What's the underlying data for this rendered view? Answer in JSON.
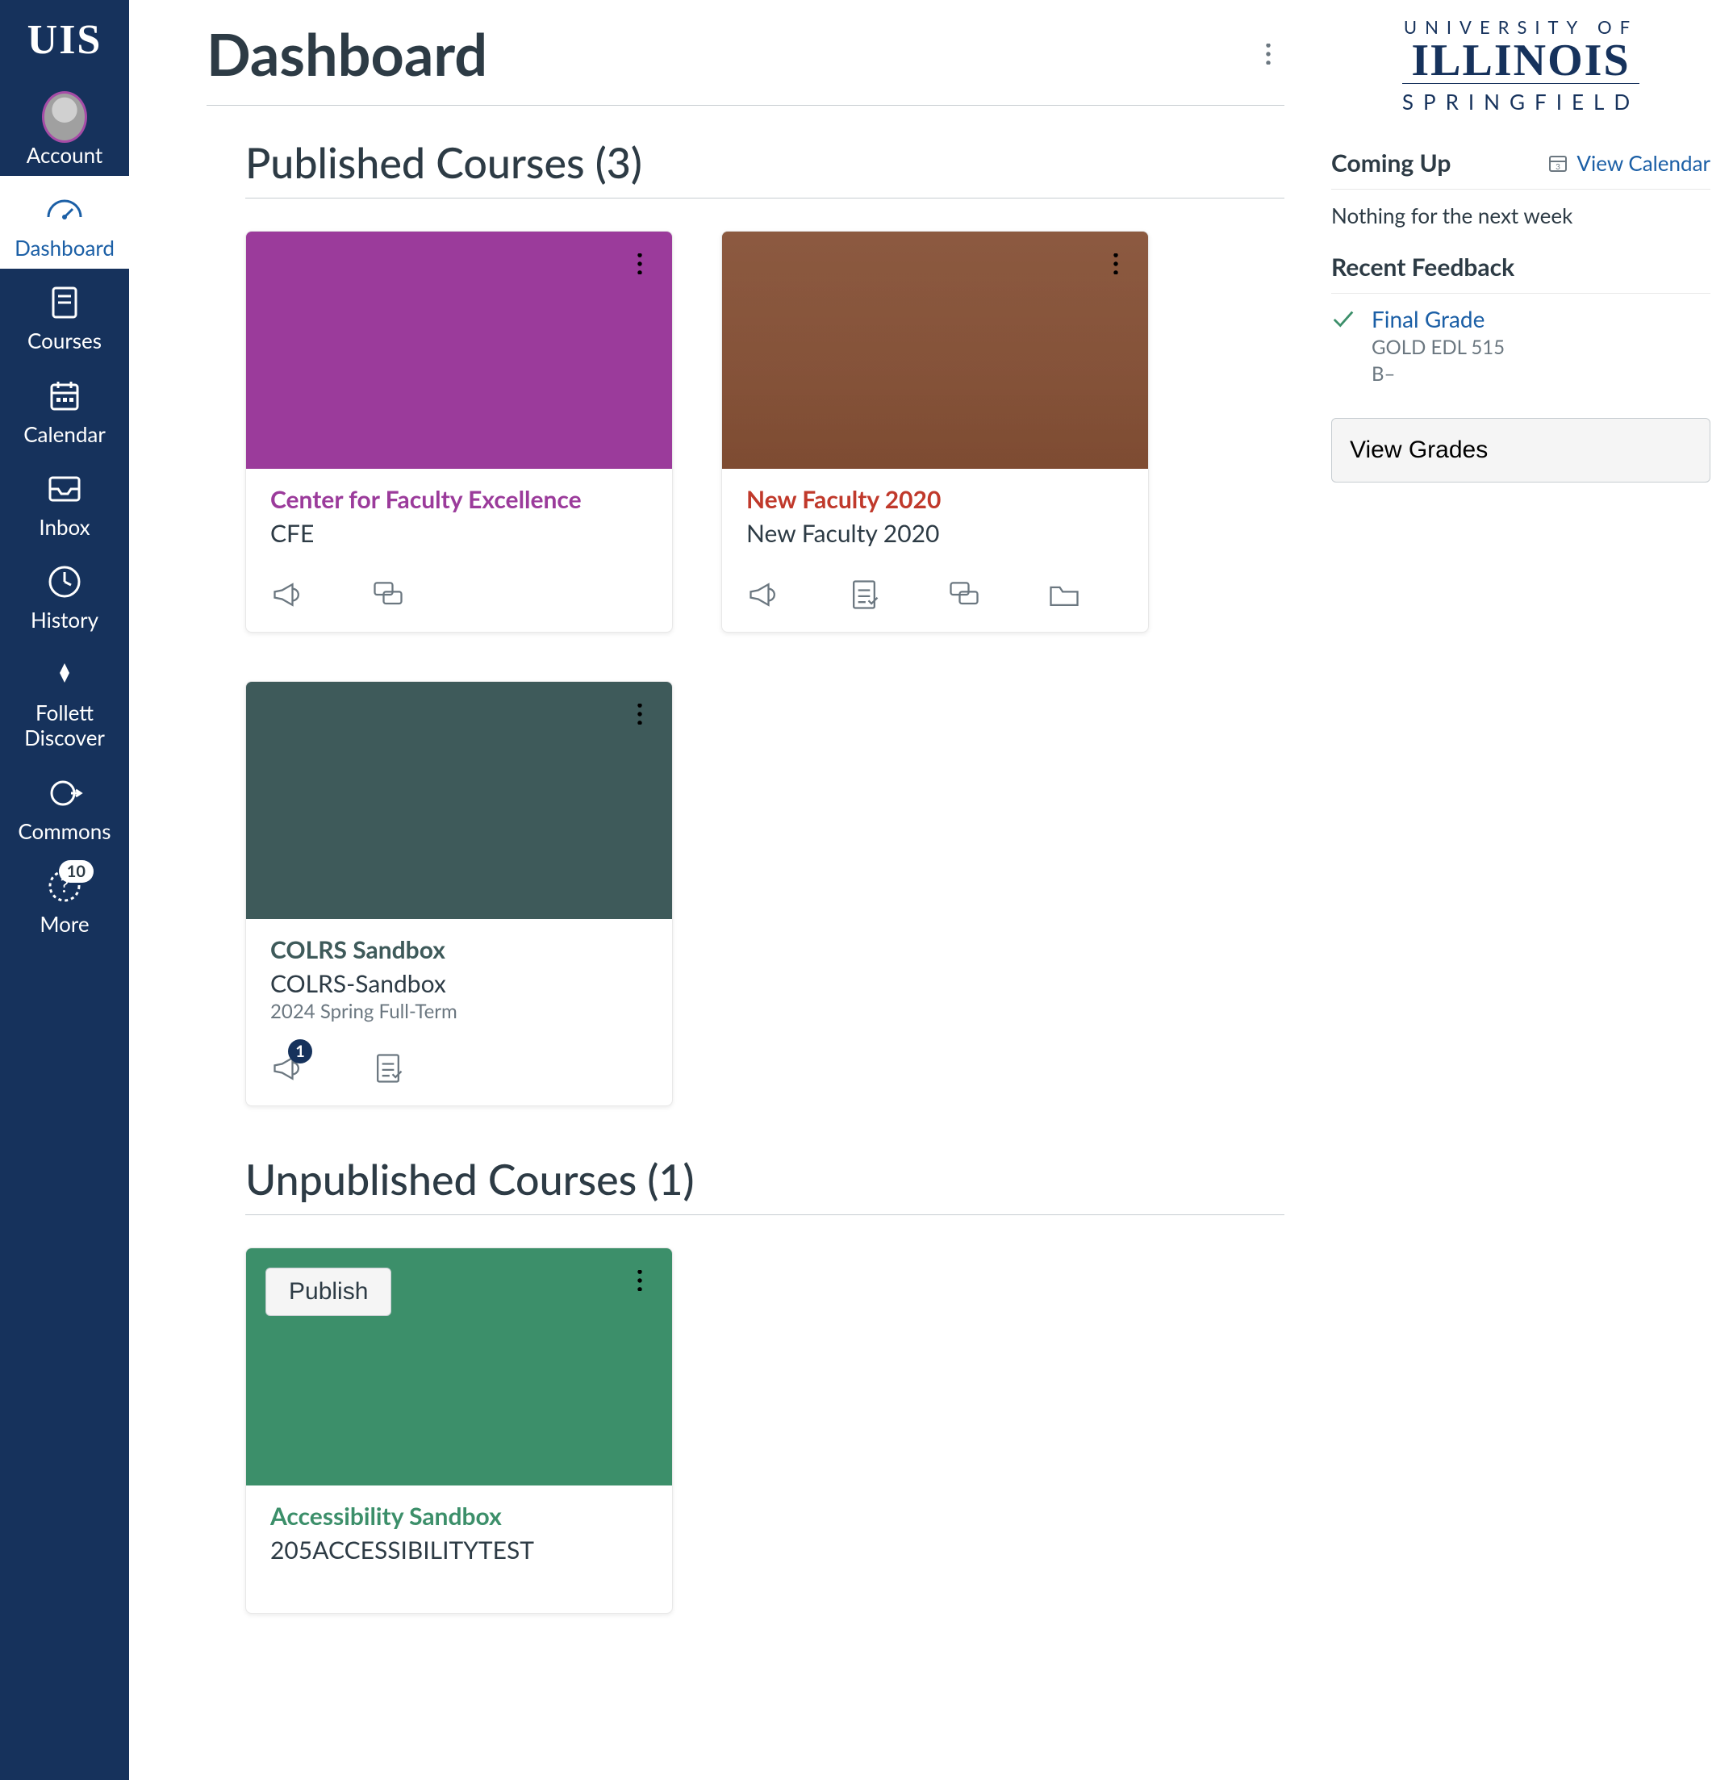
{
  "sidebar": {
    "logo": "UIS",
    "items": [
      {
        "key": "account",
        "label": "Account",
        "icon": "avatar-icon"
      },
      {
        "key": "dashboard",
        "label": "Dashboard",
        "icon": "speedometer-icon",
        "active": true
      },
      {
        "key": "courses",
        "label": "Courses",
        "icon": "book-icon"
      },
      {
        "key": "calendar",
        "label": "Calendar",
        "icon": "calendar-icon"
      },
      {
        "key": "inbox",
        "label": "Inbox",
        "icon": "inbox-icon"
      },
      {
        "key": "history",
        "label": "History",
        "icon": "clock-icon"
      },
      {
        "key": "follett",
        "label": "Follett Discover",
        "icon": "follett-icon"
      },
      {
        "key": "commons",
        "label": "Commons",
        "icon": "commons-icon"
      },
      {
        "key": "more",
        "label": "More",
        "icon": "help-icon",
        "badge": "10"
      }
    ]
  },
  "page": {
    "title": "Dashboard"
  },
  "sections": {
    "published": {
      "title": "Published Courses (3)"
    },
    "unpublished": {
      "title": "Unpublished Courses (1)"
    }
  },
  "courses": {
    "published": [
      {
        "name": "Center for Faculty Excellence",
        "code": "CFE",
        "term": "",
        "hero": "hero-purple",
        "name_color": "#9b3b9b",
        "actions": [
          "megaphone-icon",
          "discussion-icon"
        ],
        "badge": null
      },
      {
        "name": "New Faculty 2020",
        "code": "New Faculty 2020",
        "term": "",
        "hero": "hero-photo",
        "name_color": "#c0392b",
        "actions": [
          "megaphone-icon",
          "assignment-icon",
          "discussion-icon",
          "folder-icon"
        ],
        "badge": null
      },
      {
        "name": "COLRS Sandbox",
        "code": "COLRS-Sandbox",
        "term": "2024 Spring Full-Term",
        "hero": "hero-slate",
        "name_color": "#3e5a5a",
        "actions": [
          "megaphone-icon",
          "assignment-icon"
        ],
        "badge": {
          "on": "megaphone-icon",
          "value": "1"
        }
      }
    ],
    "unpublished": [
      {
        "name": "Accessibility Sandbox",
        "code": "205ACCESSIBILITYTEST",
        "term": "",
        "hero": "hero-green",
        "name_color": "#3c8f6a",
        "actions": [],
        "publish_label": "Publish"
      }
    ]
  },
  "rail": {
    "logo": {
      "line1": "UNIVERSITY OF",
      "line2": "ILLINOIS",
      "line3": "SPRINGFIELD"
    },
    "coming_up_heading": "Coming Up",
    "view_calendar_label": "View Calendar",
    "coming_up_empty": "Nothing for the next week",
    "recent_heading": "Recent Feedback",
    "feedback": [
      {
        "title": "Final Grade",
        "sub1": "GOLD EDL 515",
        "sub2": "B–"
      }
    ],
    "view_grades_label": "View Grades"
  }
}
